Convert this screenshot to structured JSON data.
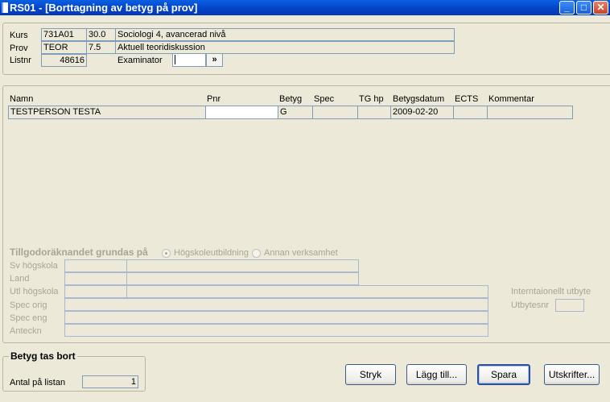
{
  "window": {
    "title": "RS01 - [Borttagning av betyg på prov]"
  },
  "course": {
    "kurs_label": "Kurs",
    "kurs_code": "731A01",
    "kurs_points": "30.0",
    "kurs_name": "Sociologi 4, avancerad nivå",
    "prov_label": "Prov",
    "prov_code": "TEOR",
    "prov_points": "7.5",
    "prov_name": "Aktuell teoridiskussion",
    "listnr_label": "Listnr",
    "listnr": "48616",
    "examinator_label": "Examinator",
    "examinator_value": "",
    "lookup_label": "»"
  },
  "grades": {
    "headers": {
      "namn": "Namn",
      "pnr": "Pnr",
      "betyg": "Betyg",
      "spec": "Spec",
      "tghp": "TG hp",
      "datum": "Betygsdatum",
      "ects": "ECTS",
      "kommentar": "Kommentar"
    },
    "rows": [
      {
        "namn": "TESTPERSON TESTA",
        "pnr": "",
        "betyg": "G",
        "spec": "",
        "tghp": "",
        "datum": "2009-02-20",
        "ects": "",
        "kommentar": ""
      }
    ]
  },
  "credit": {
    "title": "Tillgodoräknandet grundas på",
    "option1": "Högskoleutbildning",
    "option2": "Annan verksamhet",
    "selected": "option1",
    "sv_hogskola": "Sv högskola",
    "land": "Land",
    "utl_hogskola": "Utl högskola",
    "spec_orig": "Spec orig",
    "spec_eng": "Spec eng",
    "anteckn": "Anteckn",
    "intl_exchange": "Interntaionellt utbyte",
    "utbytesnr": "Utbytesnr"
  },
  "removal": {
    "legend": "Betyg tas bort",
    "count_label": "Antal på listan",
    "count": "1"
  },
  "buttons": {
    "stryk": "Stryk",
    "lagg_till": "Lägg till...",
    "spara": "Spara",
    "utskrifter": "Utskrifter..."
  }
}
